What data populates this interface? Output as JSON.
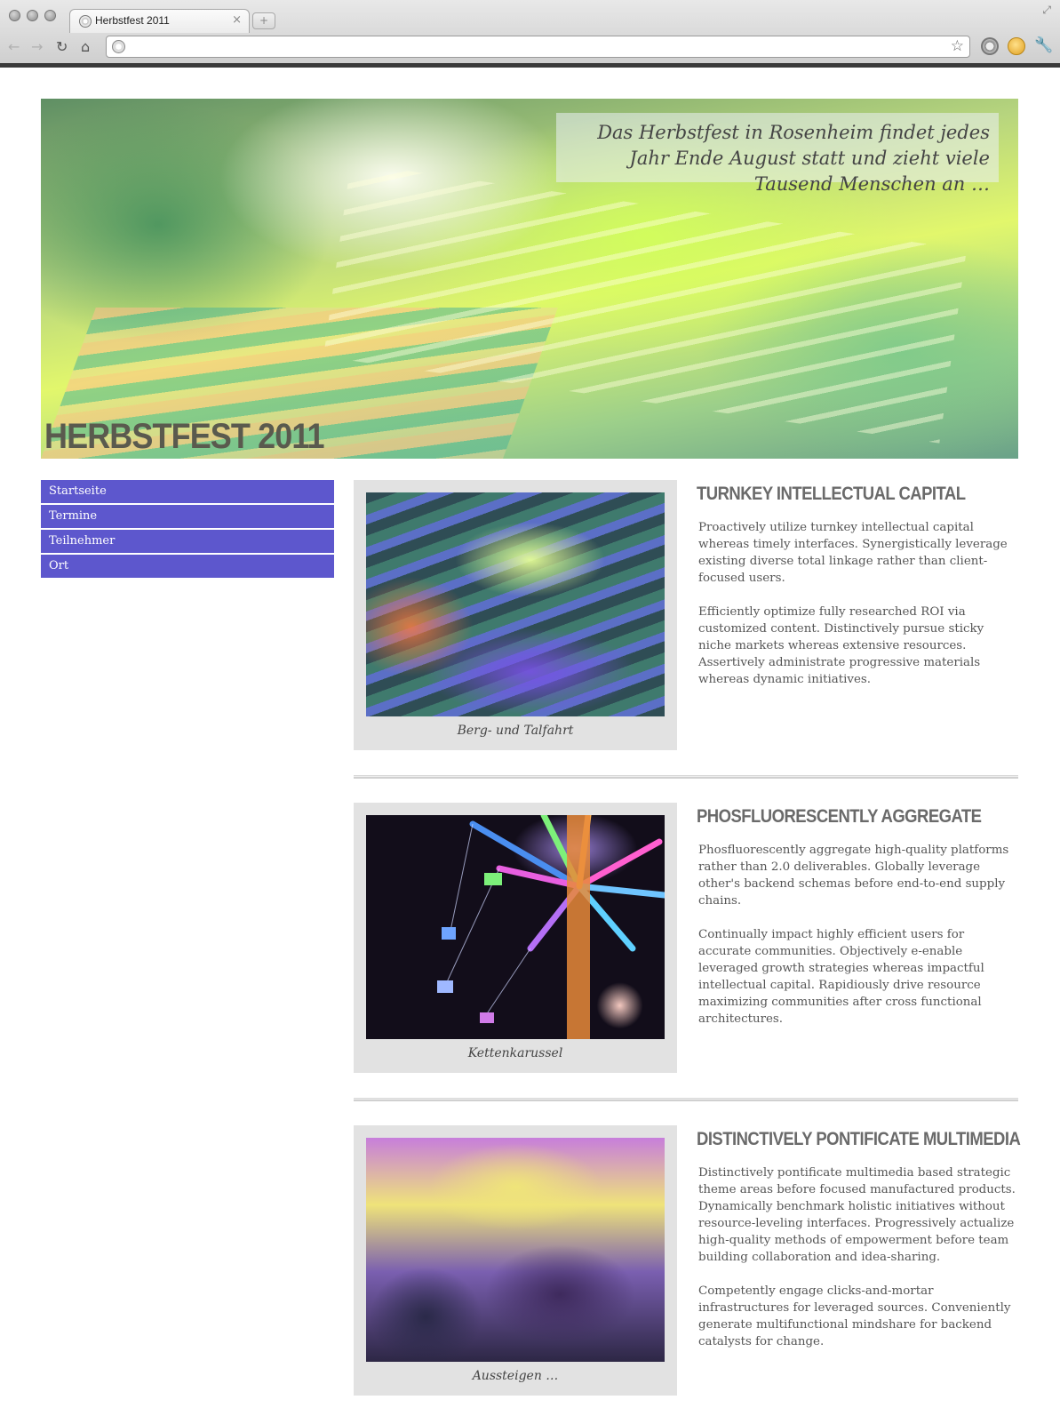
{
  "browser": {
    "tab_title": "Herbstfest 2011",
    "tab_close": "×",
    "new_tab": "+",
    "url": ""
  },
  "hero": {
    "quote": "Das Herbstfest in Rosenheim findet jedes Jahr Ende August statt und zieht viele Tausend Menschen an …",
    "title": "HERBSTFEST 2011"
  },
  "nav": {
    "items": [
      {
        "label": "Startseite"
      },
      {
        "label": "Termine"
      },
      {
        "label": "Teilnehmer"
      },
      {
        "label": "Ort"
      }
    ]
  },
  "articles": [
    {
      "title": "TURNKEY INTELLECTUAL CAPITAL",
      "caption": "Berg- und Talfahrt",
      "paragraphs": [
        "Proactively utilize turnkey intellectual capital whereas timely interfaces. Synergistically leverage existing diverse total linkage rather than client-focused users.",
        "Efficiently optimize fully researched ROI via customized content. Distinctively pursue sticky niche markets whereas extensive resources. Assertively administrate progressive materials whereas dynamic initiatives."
      ]
    },
    {
      "title": "PHOSFLUORESCENTLY AGGREGATE",
      "caption": "Kettenkarussel",
      "paragraphs": [
        "Phosfluorescently aggregate high-quality platforms rather than 2.0 deliverables. Globally leverage other's backend schemas before end-to-end supply chains.",
        "Continually impact highly efficient users for accurate communities. Objectively e-enable leveraged growth strategies whereas impactful intellectual capital. Rapidiously drive resource maximizing communities after cross functional architectures."
      ]
    },
    {
      "title": "DISTINCTIVELY PONTIFICATE MULTIMEDIA",
      "caption": "Aussteigen …",
      "paragraphs": [
        "Distinctively pontificate multimedia based strategic theme areas before focused manufactured products. Dynamically benchmark holistic initiatives without resource-leveling interfaces. Progressively actualize high-quality methods of empowerment before team building collaboration and idea-sharing.",
        "Competently engage clicks-and-mortar infrastructures for leveraged sources. Conveniently generate multifunctional mindshare for backend catalysts for change."
      ]
    }
  ],
  "icons": {
    "back": "back-arrow-icon",
    "forward": "forward-arrow-icon",
    "reload": "reload-icon",
    "home": "home-icon",
    "star": "bookmark-star-icon",
    "wrench": "wrench-icon"
  },
  "colors": {
    "nav_bg": "#5d57cd",
    "card_bg": "#e2e2e2",
    "heading": "#6a6a6a"
  }
}
